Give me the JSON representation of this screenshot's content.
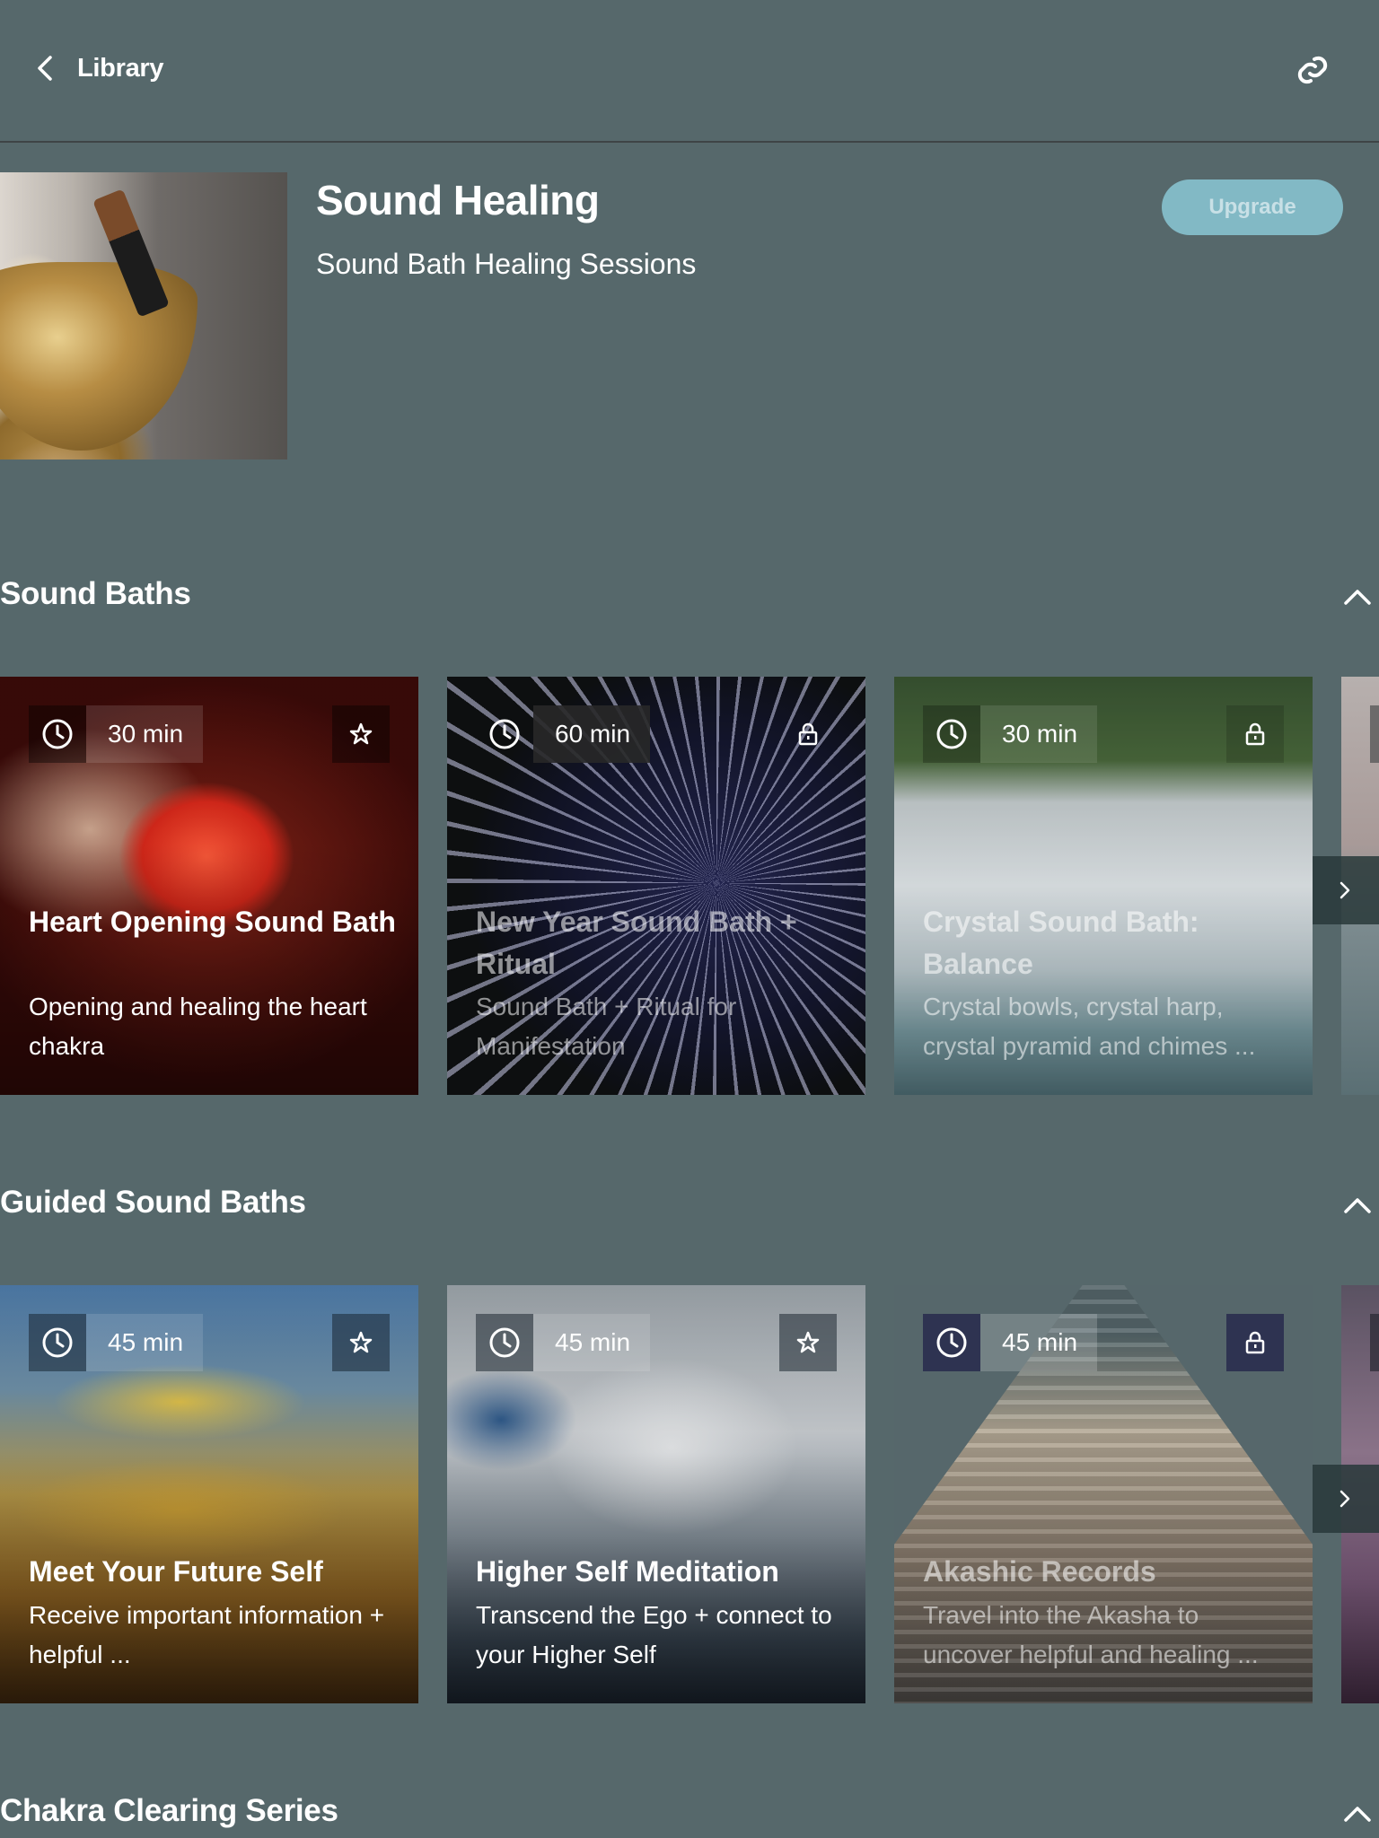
{
  "header": {
    "back_label": "Library",
    "back_icon": "chevron-left-icon",
    "share_icon": "link-icon"
  },
  "hero": {
    "title": "Sound Healing",
    "subtitle": "Sound Bath Healing Sessions",
    "upgrade_label": "Upgrade",
    "image": "singing-bowl-photo"
  },
  "colors": {
    "background": "#56686b",
    "upgrade_bg": "#82b9c5",
    "upgrade_text": "#c8e0e6"
  },
  "sections": [
    {
      "title": "Sound Baths",
      "cards": [
        {
          "duration": "30 min",
          "title": "Heart Opening Sound Bath",
          "description": "Opening and healing the heart chakra",
          "badge": "star-icon",
          "locked": false
        },
        {
          "duration": "60 min",
          "title": "New Year Sound Bath + Ritual",
          "description": "Sound Bath + Ritual for Manifestation",
          "badge": "lock-icon",
          "locked": true
        },
        {
          "duration": "30 min",
          "title": "Crystal Sound Bath: Balance",
          "description": "Crystal bowls, crystal harp, crystal pyramid and chimes ...",
          "badge": "lock-icon",
          "locked": true
        }
      ]
    },
    {
      "title": "Guided Sound Baths",
      "cards": [
        {
          "duration": "45 min",
          "title": "Meet Your Future Self",
          "description": "Receive important information + helpful ...",
          "badge": "star-icon",
          "locked": false
        },
        {
          "duration": "45 min",
          "title": "Higher Self Meditation",
          "description": "Transcend the Ego + connect to your Higher Self",
          "badge": "star-icon",
          "locked": false
        },
        {
          "duration": "45 min",
          "title": "Akashic Records",
          "description": "Travel into the Akasha to uncover helpful and healing ...",
          "badge": "lock-icon",
          "locked": true
        }
      ]
    },
    {
      "title": "Chakra Clearing Series",
      "cards": []
    }
  ]
}
